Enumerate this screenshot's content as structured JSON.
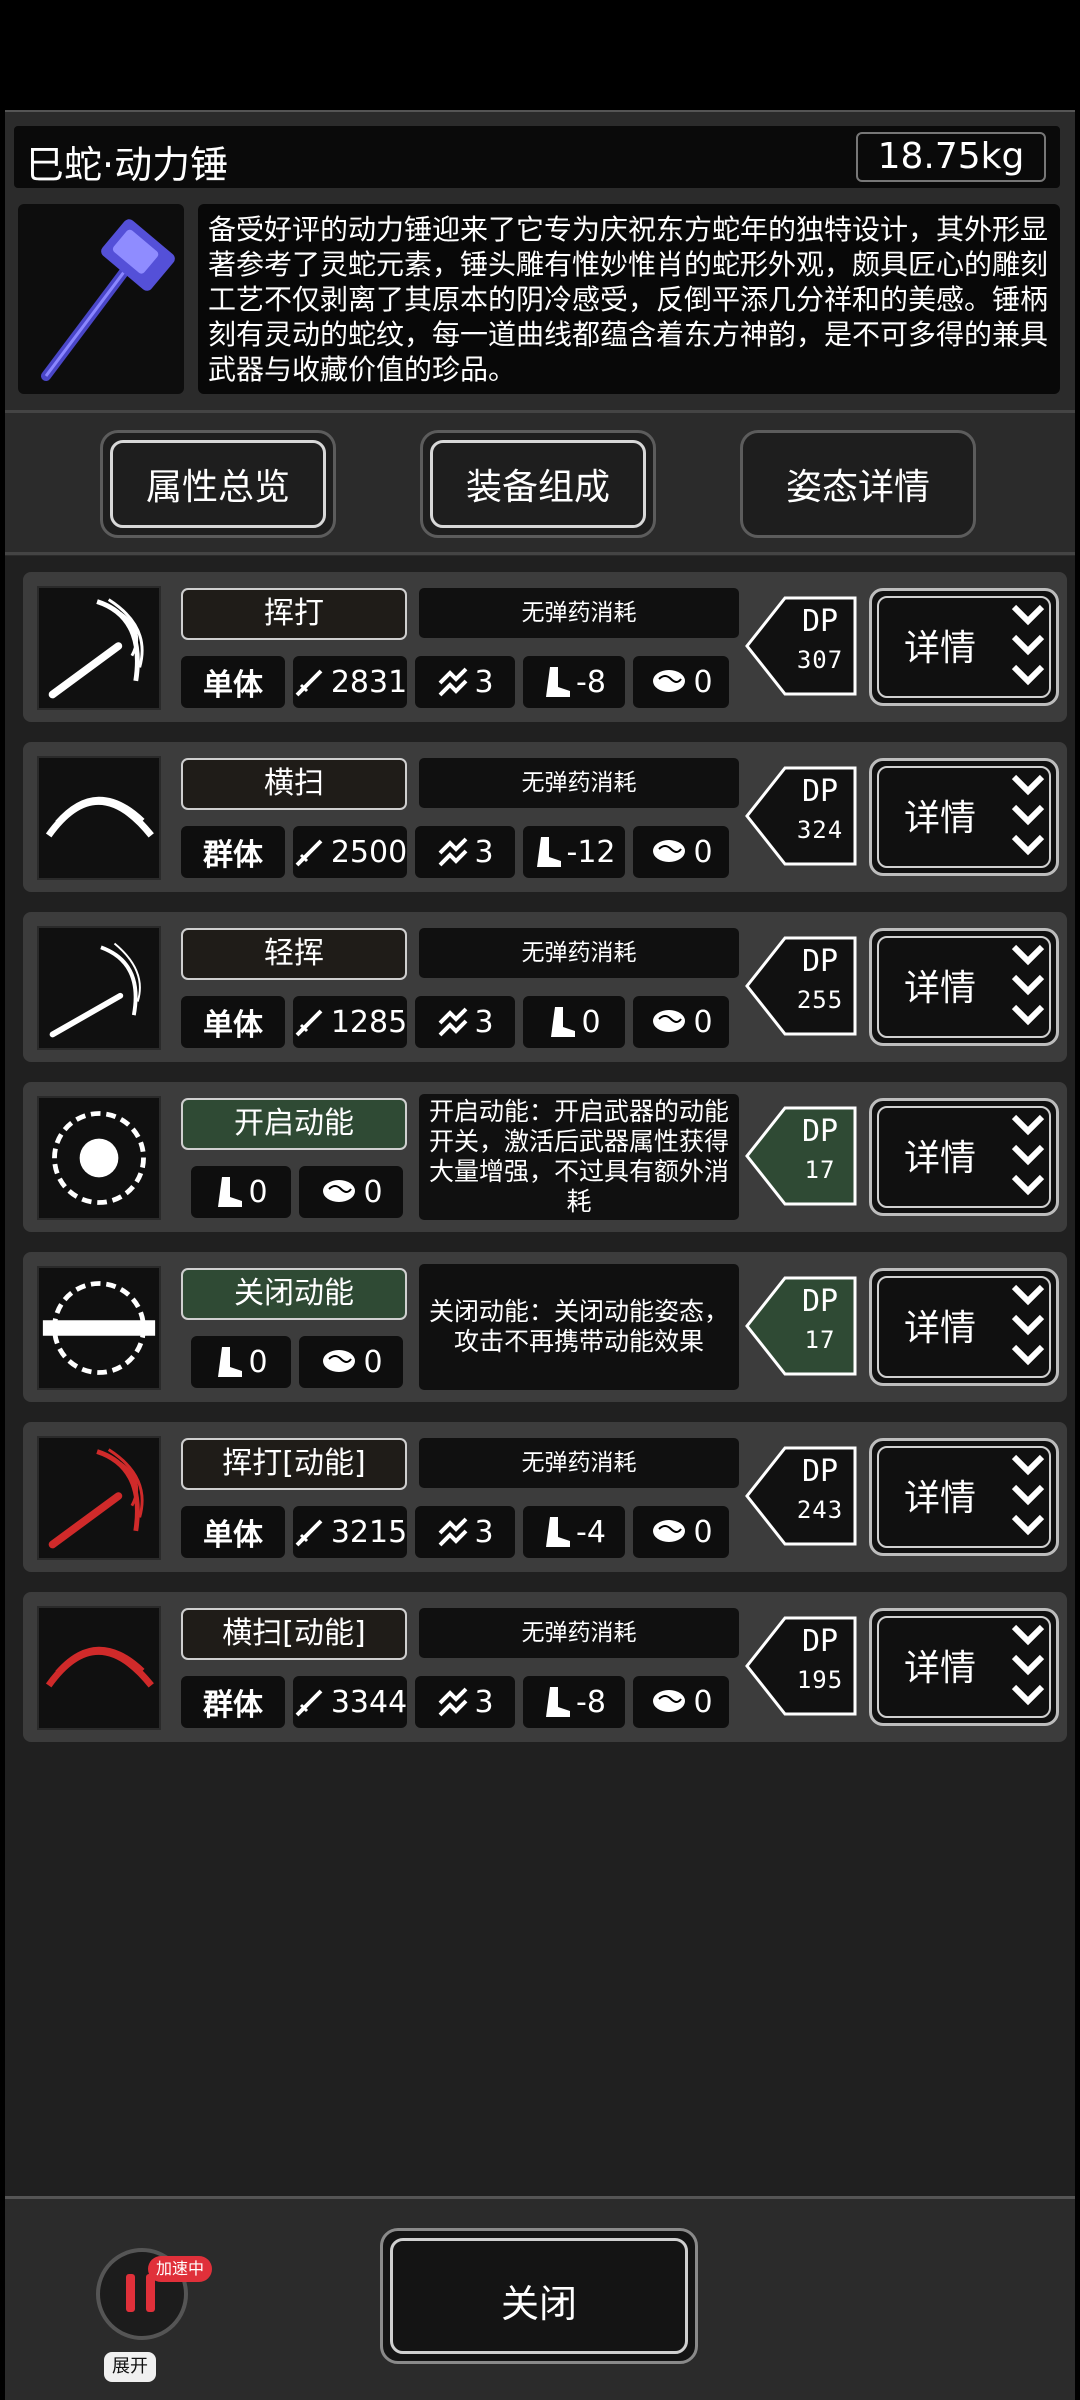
{
  "header": {
    "title": "巳蛇·动力锤",
    "weight": "18.75kg",
    "description": "备受好评的动力锤迎来了它专为庆祝东方蛇年的独特设计，其外形显著参考了灵蛇元素，锤头雕有惟妙惟肖的蛇形外观，颇具匠心的雕刻工艺不仅剥离了其原本的阴冷感受，反倒平添几分祥和的美感。锤柄刻有灵动的蛇纹，每一道曲线都蕴含着东方神韵，是不可多得的兼具武器与收藏价值的珍品。"
  },
  "tabs": [
    {
      "label": "属性总览"
    },
    {
      "label": "装备组成"
    },
    {
      "label": "姿态详情"
    }
  ],
  "skills": [
    {
      "name": "挥打",
      "info": "无弹药消耗",
      "target": "单体",
      "damage": "2831",
      "range": "3",
      "move": "-8",
      "brain": "0",
      "dp_label": "DP",
      "dp": "307",
      "detail": "详情"
    },
    {
      "name": "横扫",
      "info": "无弹药消耗",
      "target": "群体",
      "damage": "2500",
      "range": "3",
      "move": "-12",
      "brain": "0",
      "dp_label": "DP",
      "dp": "324",
      "detail": "详情"
    },
    {
      "name": "轻挥",
      "info": "无弹药消耗",
      "target": "单体",
      "damage": "1285",
      "range": "3",
      "move": "0",
      "brain": "0",
      "dp_label": "DP",
      "dp": "255",
      "detail": "详情"
    },
    {
      "name": "开启动能",
      "info": "开启动能：开启武器的动能开关，激活后武器属性获得大量增强，不过具有额外消耗",
      "move": "0",
      "brain": "0",
      "dp_label": "DP",
      "dp": "17",
      "detail": "详情"
    },
    {
      "name": "关闭动能",
      "info": "关闭动能：关闭动能姿态，攻击不再携带动能效果",
      "move": "0",
      "brain": "0",
      "dp_label": "DP",
      "dp": "17",
      "detail": "详情"
    },
    {
      "name": "挥打[动能]",
      "info": "无弹药消耗",
      "target": "单体",
      "damage": "3215",
      "range": "3",
      "move": "-4",
      "brain": "0",
      "dp_label": "DP",
      "dp": "243",
      "detail": "详情"
    },
    {
      "name": "横扫[动能]",
      "info": "无弹药消耗",
      "target": "群体",
      "damage": "3344",
      "range": "3",
      "move": "-8",
      "brain": "0",
      "dp_label": "DP",
      "dp": "195",
      "detail": "详情"
    }
  ],
  "footer": {
    "close_label": "关闭",
    "boost_badge": "加速中",
    "expand_label": "展开"
  },
  "colors": {
    "active_green": "#2f4a34",
    "dynamic_red": "#d02a2a"
  }
}
